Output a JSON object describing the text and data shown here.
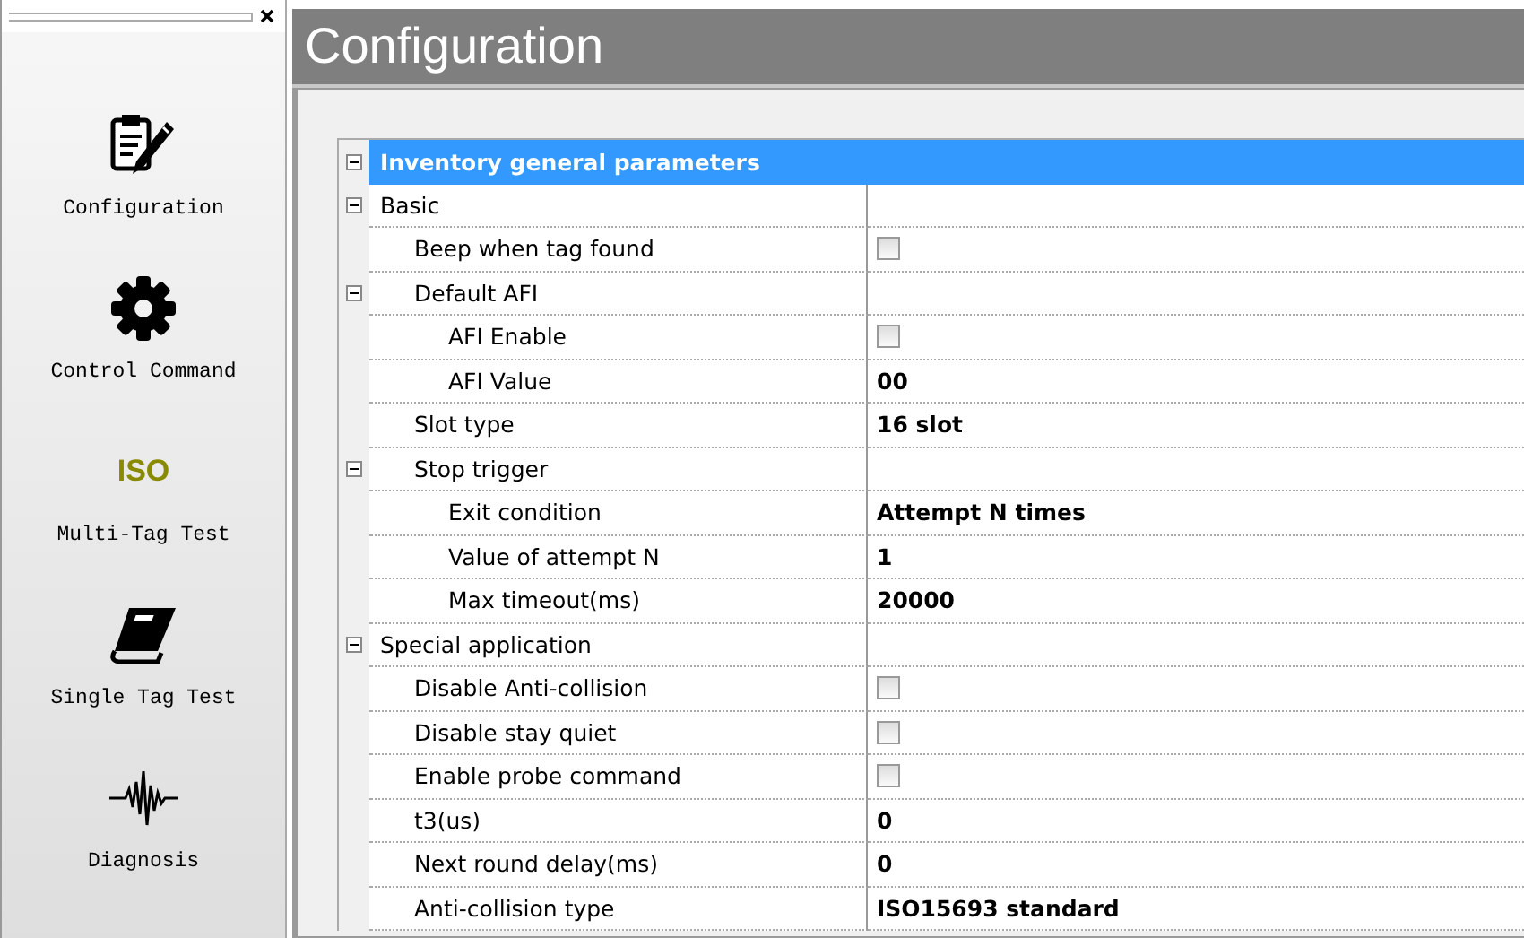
{
  "sidebar": {
    "items": [
      {
        "kind": "clipboard",
        "label": "Configuration"
      },
      {
        "kind": "gear",
        "label": "Control Command"
      },
      {
        "kind": "text",
        "icon_text": "ISO",
        "label": "Multi-Tag Test"
      },
      {
        "kind": "book",
        "label": "Single Tag Test"
      },
      {
        "kind": "wave",
        "label": "Diagnosis"
      }
    ]
  },
  "page_title": "Configuration",
  "section": {
    "title": "Inventory general parameters",
    "expanded": true,
    "items": [
      {
        "label": "Basic",
        "kind": "group",
        "expanded": true,
        "children": [
          {
            "label": "Beep when tag found",
            "kind": "checkbox",
            "checked": false
          },
          {
            "label": "Default AFI",
            "kind": "group",
            "expanded": true,
            "children": [
              {
                "label": "AFI Enable",
                "kind": "checkbox",
                "checked": false
              },
              {
                "label": "AFI Value",
                "kind": "value",
                "value": "00"
              }
            ]
          },
          {
            "label": "Slot type",
            "kind": "value",
            "value": "16 slot"
          },
          {
            "label": "Stop trigger",
            "kind": "group",
            "expanded": true,
            "children": [
              {
                "label": "Exit condition",
                "kind": "value",
                "value": "Attempt N times"
              },
              {
                "label": "Value of attempt N",
                "kind": "value",
                "value": "1"
              },
              {
                "label": "Max timeout(ms)",
                "kind": "value",
                "value": "20000"
              }
            ]
          }
        ]
      },
      {
        "label": "Special application",
        "kind": "group",
        "expanded": true,
        "children": [
          {
            "label": "Disable Anti-collision",
            "kind": "checkbox",
            "checked": false
          },
          {
            "label": "Disable stay quiet",
            "kind": "checkbox",
            "checked": false
          },
          {
            "label": "Enable probe command",
            "kind": "checkbox",
            "checked": false
          },
          {
            "label": "t3(us)",
            "kind": "value",
            "value": "0"
          },
          {
            "label": "Next round delay(ms)",
            "kind": "value",
            "value": "0"
          },
          {
            "label": "Anti-collision type",
            "kind": "value",
            "value": "ISO15693 standard"
          }
        ]
      }
    ]
  }
}
